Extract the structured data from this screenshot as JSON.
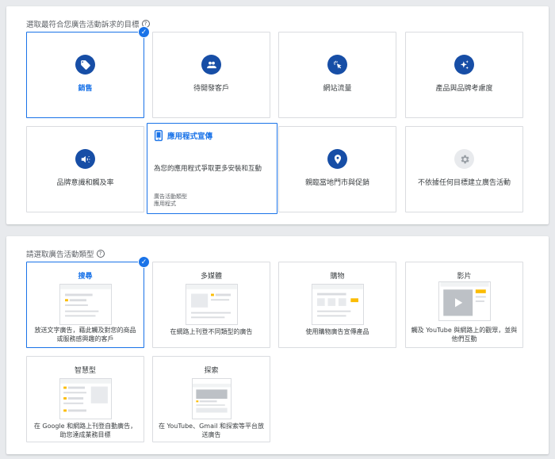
{
  "goal_section": {
    "title": "選取最符合您廣告活動訴求的目標",
    "help": "?",
    "cards": [
      {
        "label": "銷售",
        "icon": "tag-icon"
      },
      {
        "label": "待開發客戶",
        "icon": "people-icon"
      },
      {
        "label": "網站流量",
        "icon": "cursor-click-icon"
      },
      {
        "label": "產品與品牌考慮度",
        "icon": "sparkle-icon"
      },
      {
        "label": "品牌意識和觸及率",
        "icon": "megaphone-icon"
      },
      {
        "label": "應用程式宣傳",
        "icon": "phone-icon",
        "description": "為您的應用程式爭取更多安裝和互動",
        "meta_line1": "廣告活動類型",
        "meta_line2": "應用程式"
      },
      {
        "label": "親臨當地門市與促銷",
        "icon": "map-pin-icon"
      },
      {
        "label": "不依據任何目標建立廣告活動",
        "icon": "gear-icon"
      }
    ]
  },
  "type_section": {
    "title": "請選取廣告活動類型",
    "help": "?",
    "cards": [
      {
        "title": "搜尋",
        "desc": "放送文字廣告，藉此觸及對您的商品或服務感興趣的客戶"
      },
      {
        "title": "多媒體",
        "desc": "在網路上刊登不同類型的廣告"
      },
      {
        "title": "購物",
        "desc": "使用購物廣告宣傳產品"
      },
      {
        "title": "影片",
        "desc": "觸及 YouTube 與網路上的觀眾，並與他們互動"
      },
      {
        "title": "智慧型",
        "desc": "在 Google 和網路上刊登自動廣告，助您達成業務目標"
      },
      {
        "title": "探索",
        "desc": "在 YouTube、Gmail 和探索等平台放送廣告"
      }
    ]
  },
  "colors": {
    "accent": "#1a73e8",
    "icon_bg": "#174ea6",
    "border": "#dadce0",
    "yellow": "#fbbc04"
  }
}
